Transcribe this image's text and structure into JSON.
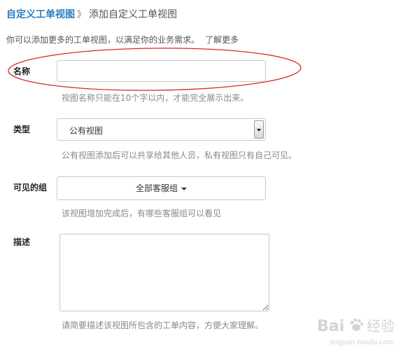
{
  "breadcrumb": {
    "parent": "自定义工单视图",
    "separator": "》",
    "current": "添加自定义工单视图"
  },
  "intro": {
    "text": "你可以添加更多的工单视图，以满足你的业务需求。",
    "more_link": "了解更多"
  },
  "form": {
    "name": {
      "label": "名称",
      "value": "",
      "hint": "视图名称只能在10个字以内，才能完全展示出来。"
    },
    "type": {
      "label": "类型",
      "selected": "公有视图",
      "hint": "公有视图添加后可以共享给其他人员，私有视图只有自己可见。"
    },
    "visible_group": {
      "label": "可见的组",
      "selected": "全部客服组",
      "hint": "该视图增加完成后，有哪些客服组可以看见"
    },
    "description": {
      "label": "描述",
      "value": "",
      "hint": "请简要描述该视图所包含的工单内容，方便大家理解。"
    }
  },
  "annotation": {
    "color": "#d9282b"
  },
  "watermark": {
    "brand_text": "Bai",
    "brand_text_2": "经验",
    "url": "jingyan.baidu.com"
  },
  "colors": {
    "link": "#2a7fc4",
    "hint": "#888888"
  }
}
